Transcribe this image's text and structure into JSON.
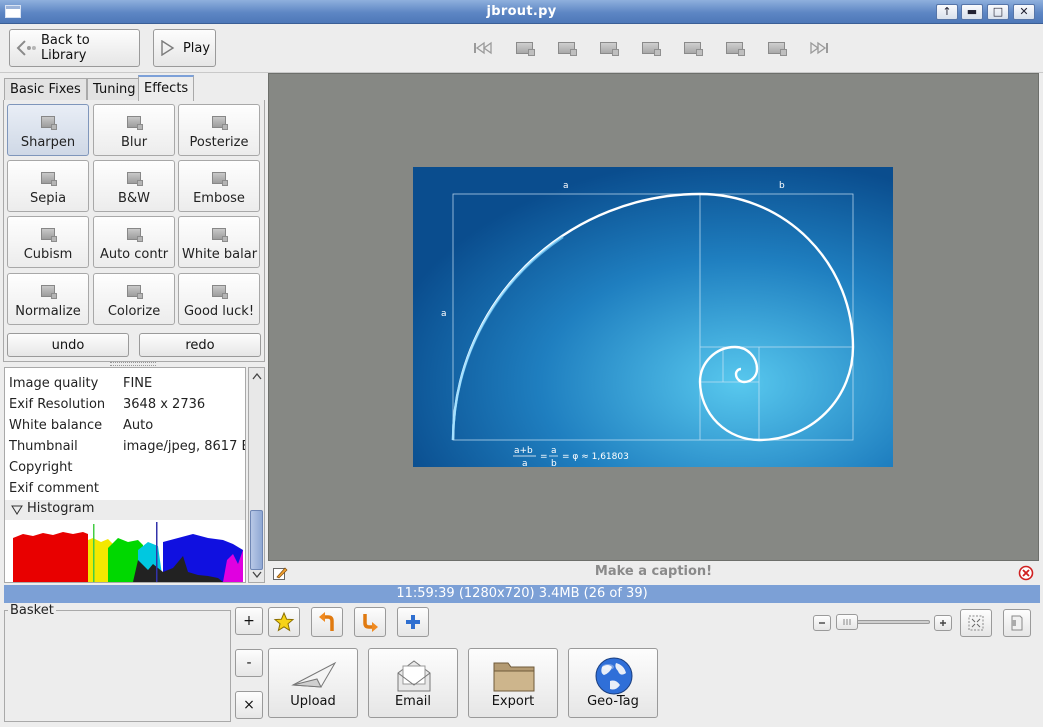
{
  "window": {
    "title": "jbrout.py"
  },
  "toolbar": {
    "back_label": "Back to Library",
    "play_label": "Play"
  },
  "tabs": [
    "Basic Fixes",
    "Tuning",
    "Effects"
  ],
  "effects": [
    "Sharpen",
    "Blur",
    "Posterize",
    "Sepia",
    "B&W",
    "Embose",
    "Cubism",
    "Auto contr",
    "White balar",
    "Normalize",
    "Colorize",
    "Good luck!"
  ],
  "actions": {
    "undo": "undo",
    "redo": "redo"
  },
  "exif": [
    {
      "key": "Image quality",
      "value": "FINE"
    },
    {
      "key": "Exif Resolution",
      "value": "3648 x 2736"
    },
    {
      "key": "White balance",
      "value": "Auto"
    },
    {
      "key": "Thumbnail",
      "value": "image/jpeg, 8617 E"
    },
    {
      "key": "Copyright",
      "value": ""
    },
    {
      "key": "Exif comment",
      "value": ""
    }
  ],
  "histogram": {
    "label": "Histogram"
  },
  "photo": {
    "label_a_top": "a",
    "label_b_top": "b",
    "label_a_left": "a",
    "formula_num1": "a+b",
    "formula_den1": "a",
    "formula_eq": "=",
    "formula_num2": "a",
    "formula_den2": "b",
    "formula_tail": "= φ ≈ 1,61803"
  },
  "caption": {
    "placeholder": "Make a caption!"
  },
  "status": {
    "text": "11:59:39 (1280x720) 3.4MB (26 of 39)"
  },
  "basket": {
    "label": "Basket",
    "add": "+",
    "remove": "-",
    "clear": "×"
  },
  "export_buttons": [
    "Upload",
    "Email",
    "Export",
    "Geo-Tag"
  ]
}
